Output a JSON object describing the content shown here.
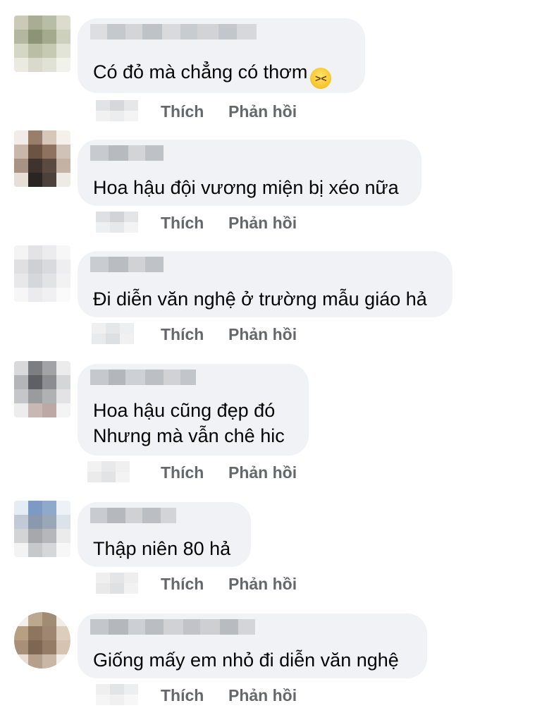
{
  "labels": {
    "like": "Thích",
    "reply": "Phản hồi"
  },
  "comments": [
    {
      "text": "Có đỏ mà chẳng có thơm",
      "emoji": "laughing-emoji"
    },
    {
      "text": "Hoa hậu đội vương miện bị xéo nữa"
    },
    {
      "text": "Đi diễn văn nghệ ở trường mẫu giáo hả"
    },
    {
      "text": "Hoa hậu cũng đẹp đó\nNhưng mà vẫn chê hic"
    },
    {
      "text": "Thập niên 80 hả"
    },
    {
      "text": "Giống mấy em nhỏ đi diễn văn nghệ"
    }
  ],
  "colors": {
    "bubble": "#f0f2f5",
    "action_text": "#65676b",
    "text": "#050505"
  }
}
